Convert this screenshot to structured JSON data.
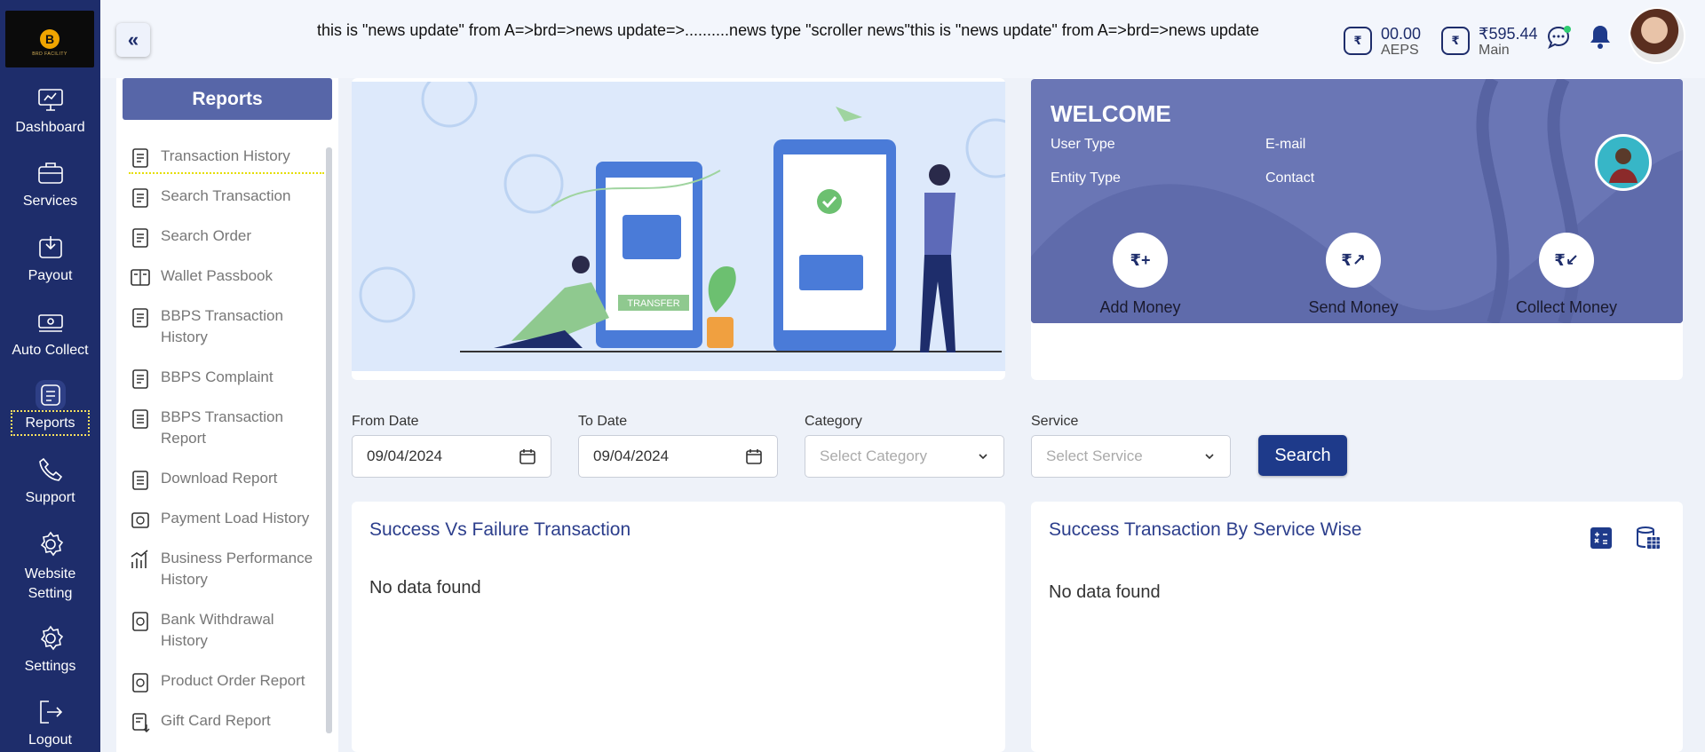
{
  "brand": {
    "logo_letter": "B",
    "logo_text": "BRD FACILITY"
  },
  "topbar": {
    "ticker": "this is \"news update\" from A=>brd=>news update=>..........news type \"scroller news\"this is \"news update\" from A=>brd=>news update",
    "wallets": [
      {
        "icon": "rupee-card-icon",
        "amount": "00.00",
        "label": "AEPS"
      },
      {
        "icon": "rupee-card-icon",
        "amount": "₹595.44",
        "label": "Main"
      }
    ],
    "wallet_icon_text": "₹"
  },
  "nav": [
    {
      "label": "Dashboard",
      "icon": "monitor-icon"
    },
    {
      "label": "Services",
      "icon": "briefcase-icon"
    },
    {
      "label": "Payout",
      "icon": "payout-icon"
    },
    {
      "label": "Auto Collect",
      "icon": "cash-icon"
    },
    {
      "label": "Reports",
      "icon": "report-icon",
      "active": true
    },
    {
      "label": "Support",
      "icon": "phone-icon"
    },
    {
      "label": "Website Setting",
      "icon": "gear-icon"
    },
    {
      "label": "Settings",
      "icon": "gear-icon"
    },
    {
      "label": "Logout",
      "icon": "logout-icon"
    }
  ],
  "reports": {
    "title": "Reports",
    "items": [
      "Transaction History",
      "Search Transaction",
      "Search Order",
      "Wallet Passbook",
      "BBPS Transaction History",
      "BBPS Complaint",
      "BBPS Transaction Report",
      "Download Report",
      "Payment Load History",
      "Business Performance History",
      "Bank Withdrawal History",
      "Product Order Report",
      "Gift Card Report"
    ]
  },
  "banner": {
    "transfer_label": "TRANSFER"
  },
  "welcome": {
    "title": "WELCOME",
    "user_type_label": "User Type",
    "email_label": "E-mail",
    "entity_type_label": "Entity Type",
    "contact_label": "Contact",
    "actions": [
      "Add Money",
      "Send Money",
      "Collect Money"
    ]
  },
  "filters": {
    "from_date_label": "From Date",
    "from_date_value": "09/04/2024",
    "to_date_label": "To Date",
    "to_date_value": "09/04/2024",
    "category_label": "Category",
    "category_placeholder": "Select Category",
    "service_label": "Service",
    "service_placeholder": "Select Service",
    "search_label": "Search"
  },
  "cards": {
    "left_title": "Success Vs Failure Transaction",
    "left_empty": "No data found",
    "right_title": "Success Transaction By Service Wise",
    "right_empty": "No data found"
  },
  "colors": {
    "nav_bg": "#1e2d6b",
    "accent": "#1e3a8a",
    "welcome_bg": "#6a76b5",
    "panel_header": "#5766a8"
  }
}
